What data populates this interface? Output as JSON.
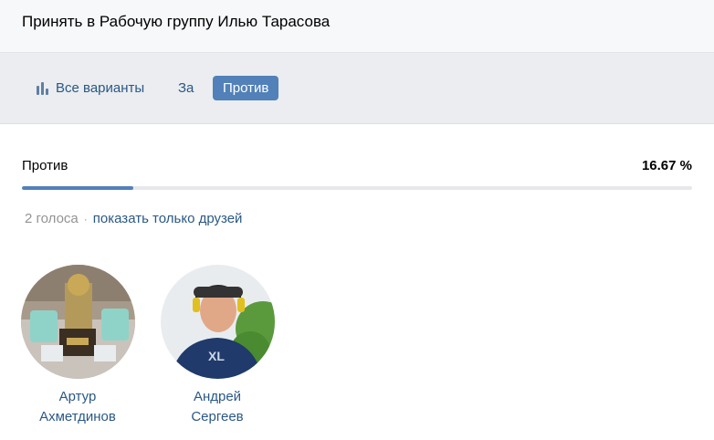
{
  "header": {
    "title": "Принять в Рабочую группу Илью Тарасова"
  },
  "tabs": [
    {
      "label": "Все варианты",
      "icon": "bar-chart-icon"
    },
    {
      "label": "За"
    },
    {
      "label": "Против",
      "active": true
    }
  ],
  "result": {
    "label": "Против",
    "percent_text": "16.67 %",
    "fraction": 0.1667,
    "accent_color": "#5181b8"
  },
  "votes": {
    "count_text": "2 голоса",
    "separator": "·",
    "friends_link": "показать только друзей"
  },
  "voters": [
    {
      "first_name": "Артур",
      "last_name": "Ахметдинов"
    },
    {
      "first_name": "Андрей",
      "last_name": "Сергеев"
    }
  ]
}
